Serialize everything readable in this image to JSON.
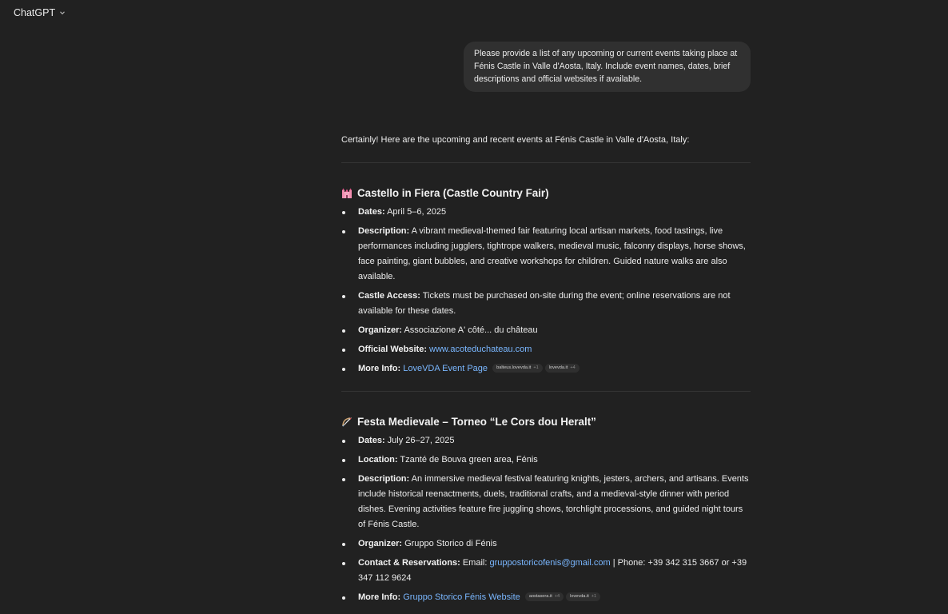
{
  "header": {
    "model_name": "ChatGPT"
  },
  "user_message": "Please provide a list of any upcoming or current events taking place at Fénis Castle in Valle d'Aosta, Italy. Include event names, dates,  brief descriptions and official websites if available.",
  "assistant": {
    "intro": "Certainly! Here are the upcoming and recent events at Fénis Castle in Valle d'Aosta, Italy:",
    "events": [
      {
        "icon": "castle-icon",
        "title": "Castello in Fiera (Castle Country Fair)",
        "dates_label": "Dates:",
        "dates": " April 5–6, 2025",
        "desc_label": "Description:",
        "desc": " A vibrant medieval-themed fair featuring local artisan markets, food tastings, live performances including jugglers, tightrope walkers, medieval music, falconry displays, horse shows, face painting, giant bubbles, and creative workshops for children. Guided nature walks are also available.",
        "access_label": "Castle Access:",
        "access": " Tickets must be purchased on-site during the event; online reservations are not available for these dates.",
        "organizer_label": "Organizer:",
        "organizer": " Associazione A' côté... du château",
        "website_label": "Official Website:",
        "website": "www.acoteduchateau.com",
        "more_label": "More Info:",
        "more_link": "LoveVDA Event Page",
        "chips": [
          {
            "label": "balteus.lovevda.it",
            "count": "+1"
          },
          {
            "label": "lovevda.it",
            "count": "+4"
          }
        ]
      },
      {
        "icon": "archery-icon",
        "title": "Festa Medievale – Torneo “Le Cors dou Heralt”",
        "dates_label": "Dates:",
        "dates": " July 26–27, 2025",
        "location_label": "Location:",
        "location": " Tzanté de Bouva green area, Fénis",
        "desc_label": "Description:",
        "desc": " An immersive medieval festival featuring knights, jesters, archers, and artisans. Events include historical reenactments, duels, traditional crafts, and a medieval-style dinner with period dishes. Evening activities feature fire juggling shows, torchlight processions, and guided night tours of Fénis Castle.",
        "organizer_label": "Organizer:",
        "organizer": " Gruppo Storico di Fénis",
        "contact_label": "Contact & Reservations:",
        "contact_prefix": " Email: ",
        "email": "gruppostoricofenis@gmail.com",
        "contact_suffix": " | Phone: +39 342 315 3667 or +39 347 112 9624",
        "more_label": "More Info:",
        "more_link": "Gruppo Storico Fénis Website",
        "chips": [
          {
            "label": "aostasera.it",
            "count": "+4"
          },
          {
            "label": "lovevda.it",
            "count": "+1"
          }
        ]
      }
    ]
  },
  "colors": {
    "background": "#212121",
    "bubble": "#303030",
    "link": "#7ab7ff",
    "text": "#ececec"
  }
}
